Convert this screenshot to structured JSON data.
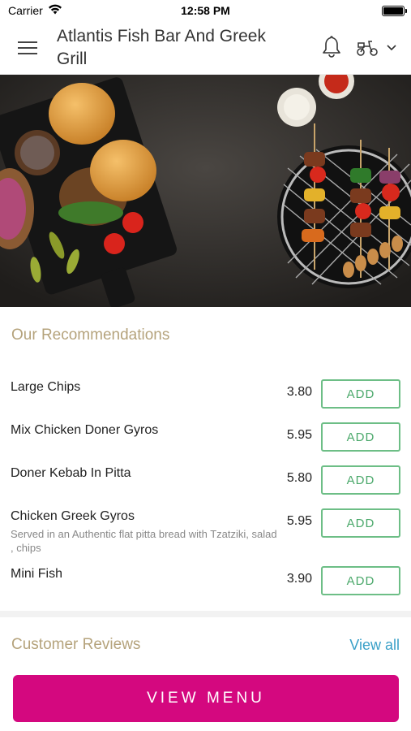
{
  "status_bar": {
    "carrier": "Carrier",
    "time": "12:58 PM"
  },
  "header": {
    "title": "Atlantis Fish Bar And Greek Grill",
    "icons": [
      "menu-icon",
      "bell-icon",
      "scooter-icon",
      "chevron-down-icon"
    ]
  },
  "recommendations": {
    "title": "Our Recommendations",
    "items": [
      {
        "name": "Large Chips",
        "description": "",
        "price": "3.80",
        "add_label": "ADD"
      },
      {
        "name": "Mix Chicken Doner Gyros",
        "description": "",
        "price": "5.95",
        "add_label": "ADD"
      },
      {
        "name": "Doner Kebab In Pitta",
        "description": "",
        "price": "5.80",
        "add_label": "ADD"
      },
      {
        "name": "Chicken Greek Gyros",
        "description": "Served in an Authentic flat pitta bread with Tzatziki, salad , chips",
        "price": "5.95",
        "add_label": "ADD"
      },
      {
        "name": "Mini Fish",
        "description": "",
        "price": "3.90",
        "add_label": "ADD"
      }
    ]
  },
  "reviews": {
    "title": "Customer Reviews",
    "view_all": "View all"
  },
  "footer": {
    "view_menu_label": "VIEW MENU"
  },
  "colors": {
    "accent_gold": "#b5a37c",
    "add_green": "#6dbe86",
    "link_blue": "#3aa0c8",
    "cta_magenta": "#d4087f"
  }
}
